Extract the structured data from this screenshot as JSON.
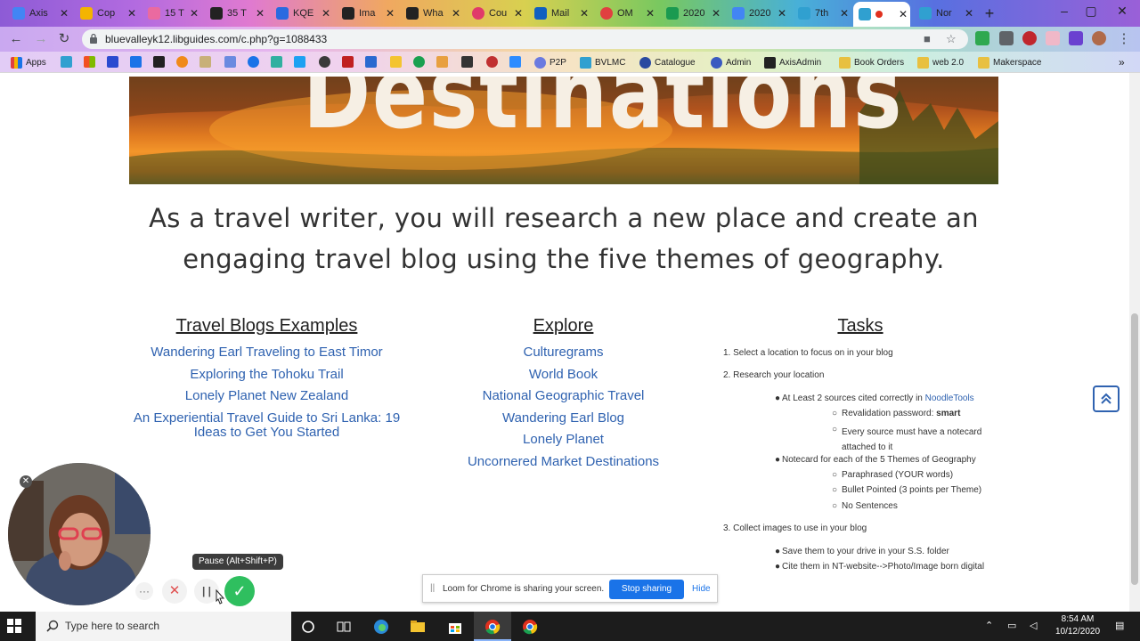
{
  "browser": {
    "tabs": [
      {
        "title": "Axis",
        "color": "#4285f4"
      },
      {
        "title": "Cop",
        "color": "#f4b400"
      },
      {
        "title": "15 T",
        "color": "#ea6aa0"
      },
      {
        "title": "35 T",
        "color": "#222222"
      },
      {
        "title": "KQE",
        "color": "#2a6ae0"
      },
      {
        "title": "Ima",
        "color": "#222222"
      },
      {
        "title": "Wha",
        "color": "#222222"
      },
      {
        "title": "Cou",
        "color": "#e03a6a"
      },
      {
        "title": "Mail",
        "color": "#1060c0"
      },
      {
        "title": "OM",
        "color": "#e04040"
      },
      {
        "title": "2020",
        "color": "#1a9a50"
      },
      {
        "title": "2020",
        "color": "#4285f4"
      },
      {
        "title": "7th",
        "color": "#30a0d0"
      },
      {
        "title": "",
        "color": "#30a0d0"
      },
      {
        "title": "Nor",
        "color": "#30a0d0"
      }
    ],
    "url": "bluevalleyk12.libguides.com/c.php?g=1088433",
    "bookmarks": [
      "Apps",
      "P2P",
      "BVLMC",
      "Catalogue",
      "Admin",
      "AxisAdmin",
      "Book Orders",
      "web 2.0",
      "Makerspace"
    ]
  },
  "page": {
    "banner_title": "Destinations",
    "headline": "As a travel writer, you will research a new place and create an engaging travel blog using the five themes of geography.",
    "col1": {
      "heading": "Travel Blogs Examples",
      "links": [
        "Wandering Earl Traveling to East Timor",
        "Exploring the Tohoku Trail",
        "Lonely Planet New Zealand",
        "An Experiential Travel Guide to Sri Lanka: 19 Ideas to Get You Started"
      ]
    },
    "col2": {
      "heading": "Explore",
      "links": [
        "Culturegrams",
        "World Book",
        "National Geographic Travel",
        "Wandering Earl Blog",
        "Lonely Planet",
        "Uncornered Market Destinations"
      ]
    },
    "tasks": {
      "heading": "Tasks",
      "step1": "1. Select a location to focus on in your blog",
      "step2": "2. Research your location",
      "b1_prefix": "At Least 2 sources cited correctly in ",
      "b1_link": "NoodleTools",
      "b1a_prefix": "Revalidation password: ",
      "b1a_bold": "smart",
      "b1b_line1": "Every source must have a notecard",
      "b1b_line2": "attached to it",
      "b2": "Notecard for each of the 5 Themes of Geography",
      "b2a": "Paraphrased (YOUR words)",
      "b2b": "Bullet Pointed (3 points per Theme)",
      "b2c": "No Sentences",
      "step3": "3. Collect images to use in your blog",
      "b3": "Save them to your drive in your S.S. folder",
      "b4": "Cite them in NT-website-->Photo/Image born digital"
    }
  },
  "loom": {
    "tooltip": "Pause (Alt+Shift+P)",
    "share_msg": "Loom for Chrome is sharing your screen.",
    "stop_label": "Stop sharing",
    "hide_label": "Hide"
  },
  "taskbar": {
    "search_placeholder": "Type here to search",
    "time": "8:54 AM",
    "date": "10/12/2020"
  }
}
